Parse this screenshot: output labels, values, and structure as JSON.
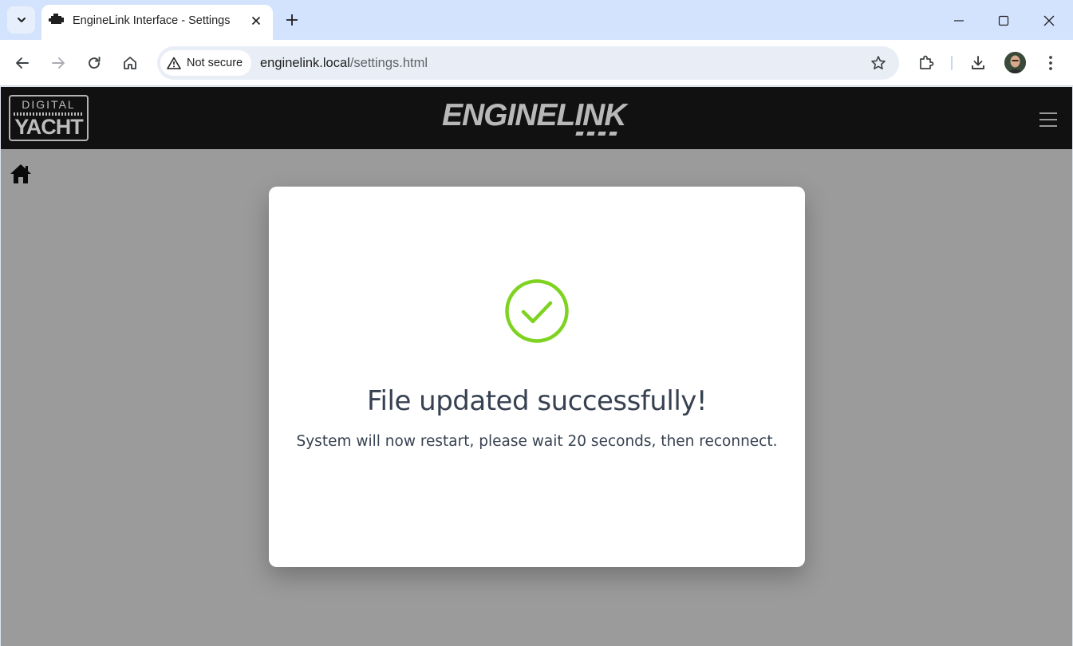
{
  "browser": {
    "tab_title": "EngineLink Interface - Settings",
    "security_label": "Not secure",
    "url_host": "enginelink.local",
    "url_path": "/settings.html"
  },
  "site": {
    "logo_top": "DIGITAL",
    "logo_bottom": "YACHT",
    "brand": "ENGINELINK"
  },
  "modal": {
    "title": "File updated successfully!",
    "message": "System will now restart, please wait 20 seconds, then reconnect.",
    "success_color": "#7ed321"
  }
}
